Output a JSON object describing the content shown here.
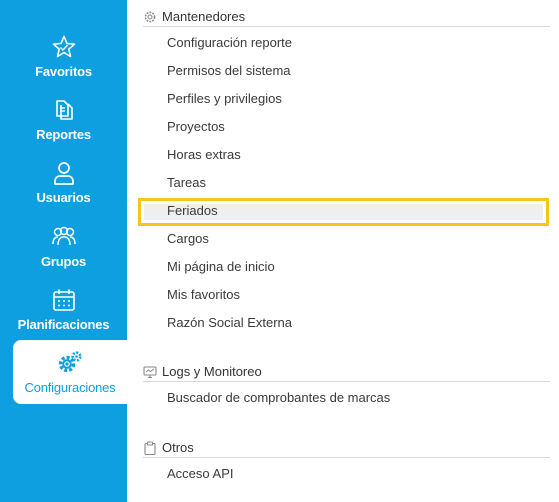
{
  "sidebar": {
    "items": [
      {
        "label": "Favoritos",
        "icon": "star-icon"
      },
      {
        "label": "Reportes",
        "icon": "documents-icon"
      },
      {
        "label": "Usuarios",
        "icon": "user-icon"
      },
      {
        "label": "Grupos",
        "icon": "users-group-icon"
      },
      {
        "label": "Planificaciones",
        "icon": "calendar-icon"
      },
      {
        "label": "Configuraciones",
        "icon": "gears-icon",
        "active": true
      }
    ]
  },
  "sections": {
    "mantenedores": {
      "title": "Mantenedores",
      "icon": "gear-icon",
      "links": [
        "Configuración reporte",
        "Permisos del sistema",
        "Perfiles y privilegios",
        "Proyectos",
        "Horas extras",
        "Tareas",
        "Feriados",
        "Cargos",
        "Mi página de inicio",
        "Mis favoritos",
        "Razón Social Externa"
      ],
      "highlighted": "Feriados"
    },
    "logs": {
      "title": "Logs y Monitoreo",
      "icon": "monitor-icon",
      "links": [
        "Buscador de comprobantes de marcas"
      ]
    },
    "otros": {
      "title": "Otros",
      "icon": "clipboard-icon",
      "links": [
        "Acceso API"
      ]
    }
  },
  "colors": {
    "sidebar": "#0d9fe0",
    "highlight_border": "#f5c518",
    "highlight_fill": "#efefef"
  }
}
